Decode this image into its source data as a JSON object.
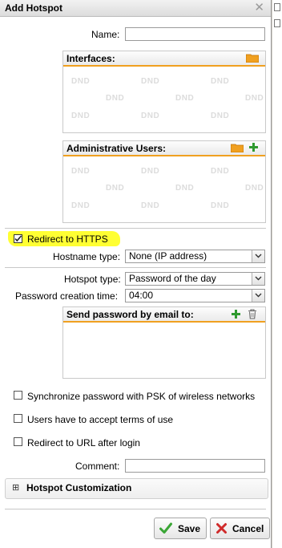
{
  "window": {
    "title": "Add Hotspot"
  },
  "form": {
    "name_label": "Name:",
    "name_value": "",
    "interfaces": {
      "title": "Interfaces:",
      "placeholder": "DND"
    },
    "admin_users": {
      "title": "Administrative Users:",
      "placeholder": "DND"
    },
    "redirect_https": {
      "label": "Redirect to HTTPS",
      "checked": true
    },
    "hostname_type": {
      "label": "Hostname type:",
      "value": "None (IP address)"
    },
    "hotspot_type": {
      "label": "Hotspot type:",
      "value": "Password of the day"
    },
    "password_creation_time": {
      "label": "Password creation time:",
      "value": "04:00"
    },
    "send_password": {
      "title": "Send password by email to:"
    },
    "sync_psk": {
      "label": "Synchronize password with PSK of wireless networks",
      "checked": false
    },
    "accept_terms": {
      "label": "Users have to accept terms of use",
      "checked": false
    },
    "redirect_url": {
      "label": "Redirect to URL after login",
      "checked": false
    },
    "comment_label": "Comment:",
    "comment_value": "",
    "customization": {
      "label": "Hotspot Customization",
      "expander": "⊞"
    }
  },
  "buttons": {
    "save": "Save",
    "cancel": "Cancel"
  },
  "colors": {
    "accent": "#f0a020",
    "highlight": "#ffff33",
    "save_icon": "#3aa635",
    "cancel_icon": "#d02b2b",
    "add_icon": "#2f9a2f"
  }
}
